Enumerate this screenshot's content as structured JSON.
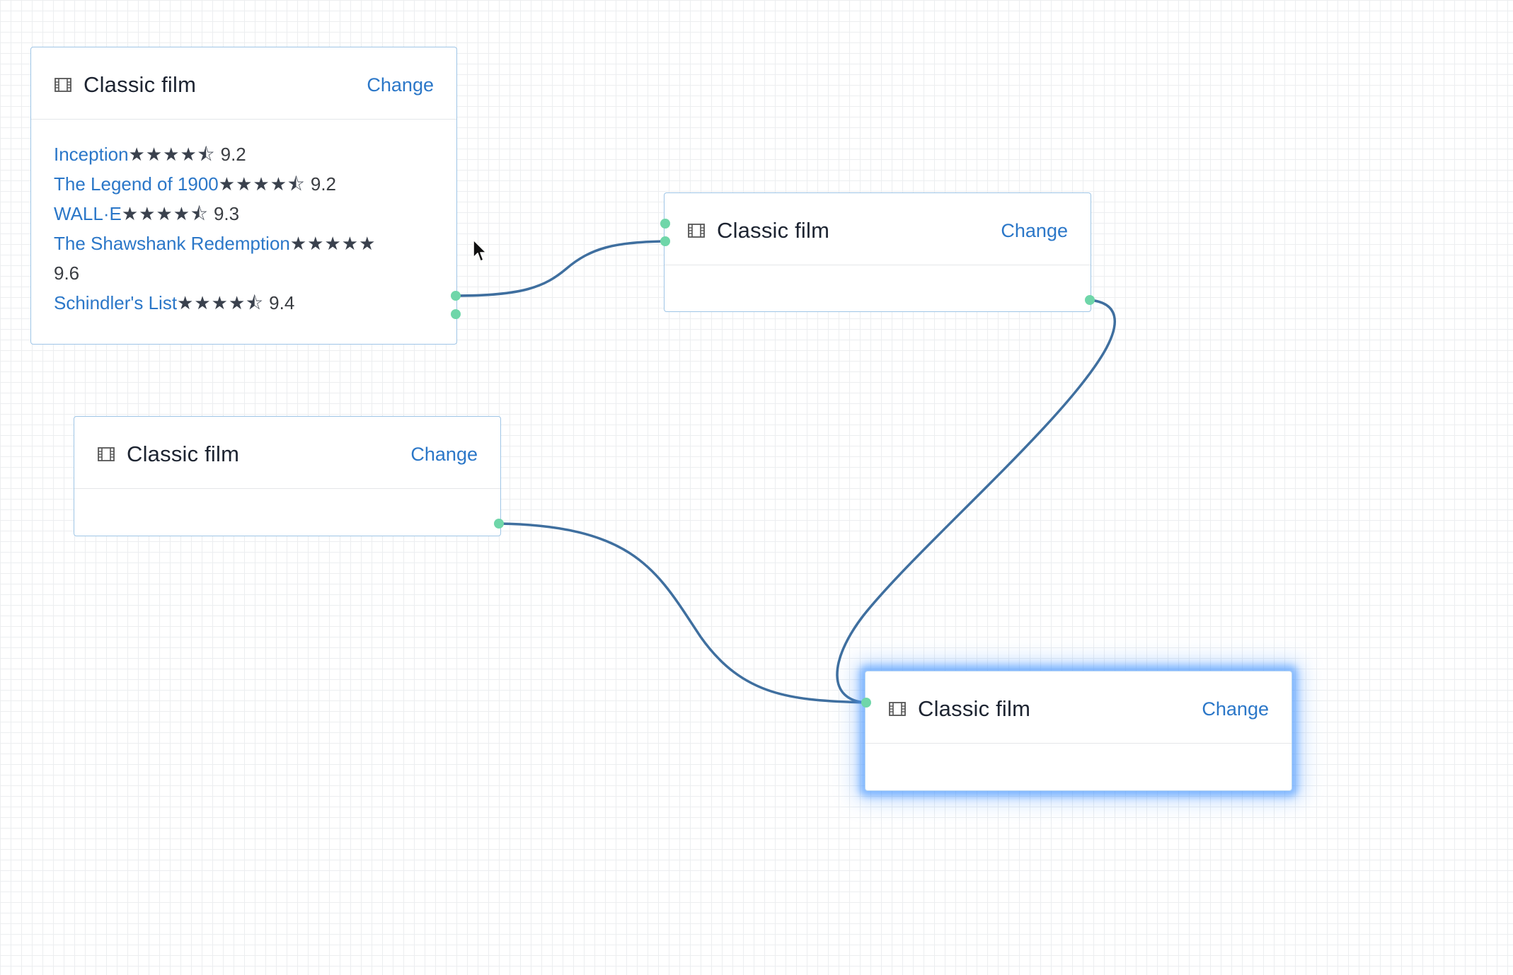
{
  "nodes": [
    {
      "title": "Classic film",
      "change_label": "Change",
      "films": [
        {
          "name": "Inception",
          "stars": "★★★★⯪",
          "rating_value": 4.5,
          "rating": "9.2"
        },
        {
          "name": "The Legend of 1900",
          "stars": "★★★★⯪",
          "rating_value": 4.5,
          "rating": "9.2"
        },
        {
          "name": "WALL·E",
          "stars": "★★★★⯪",
          "rating_value": 4.5,
          "rating": "9.3"
        },
        {
          "name": "The Shawshank Redemption",
          "stars": "★★★★★",
          "rating_value": 5,
          "rating": "9.6"
        },
        {
          "name": "Schindler's List",
          "stars": "★★★★⯪",
          "rating_value": 4.5,
          "rating": "9.4"
        }
      ]
    },
    {
      "title": "Classic film",
      "change_label": "Change"
    },
    {
      "title": "Classic film",
      "change_label": "Change"
    },
    {
      "title": "Classic film",
      "change_label": "Change",
      "selected": true
    }
  ],
  "icons": {
    "node_icon": "film-icon",
    "cursor": "mouse-pointer-icon"
  },
  "colors": {
    "link": "#2b77c8",
    "edge": "#3f6f9f",
    "port": "#6fd6a9",
    "node_border": "#9ec5e6",
    "selection_glow": "#4696ff"
  }
}
